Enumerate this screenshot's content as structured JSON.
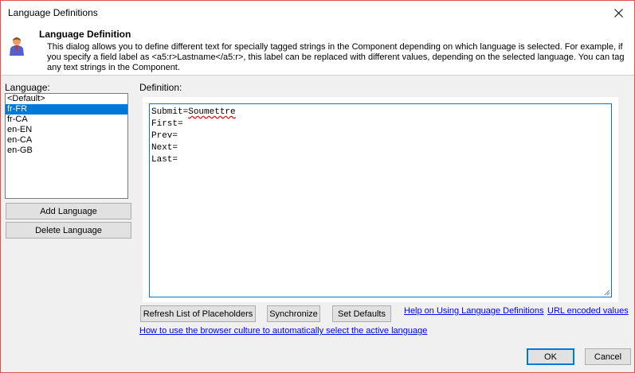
{
  "window": {
    "title": "Language Definitions"
  },
  "header": {
    "title": "Language Definition",
    "description": "This dialog allows you to define different text for specially tagged strings in the Component depending on which language is selected. For example, if you specify a field label as <a5:r>Lastname</a5:r>, this label can be replaced with different values, depending on the selected language. You can tag any text strings in the Component."
  },
  "languages": {
    "label": "Language:",
    "items": [
      "<Default>",
      "fr-FR",
      "fr-CA",
      "en-EN",
      "en-CA",
      "en-GB"
    ],
    "selected": "fr-FR"
  },
  "buttons": {
    "add_language": "Add Language",
    "delete_language": "Delete Language",
    "refresh_placeholders": "Refresh List of Placeholders",
    "synchronize": "Synchronize",
    "set_defaults": "Set Defaults",
    "ok": "OK",
    "cancel": "Cancel"
  },
  "definition": {
    "label": "Definition:",
    "lines": [
      {
        "key": "Submit=",
        "value": "Soumettre"
      },
      {
        "key": "First=",
        "value": ""
      },
      {
        "key": "Prev=",
        "value": ""
      },
      {
        "key": "Next=",
        "value": ""
      },
      {
        "key": "Last=",
        "value": ""
      }
    ]
  },
  "links": {
    "help": "Help on Using Language Definitions",
    "url_encoded": "URL encoded values",
    "browser_culture": "How to use the browser culture to automatically select the active language"
  },
  "colors": {
    "selection": "#0078d7",
    "link": "#0000ff",
    "window_border": "#d9534f"
  }
}
